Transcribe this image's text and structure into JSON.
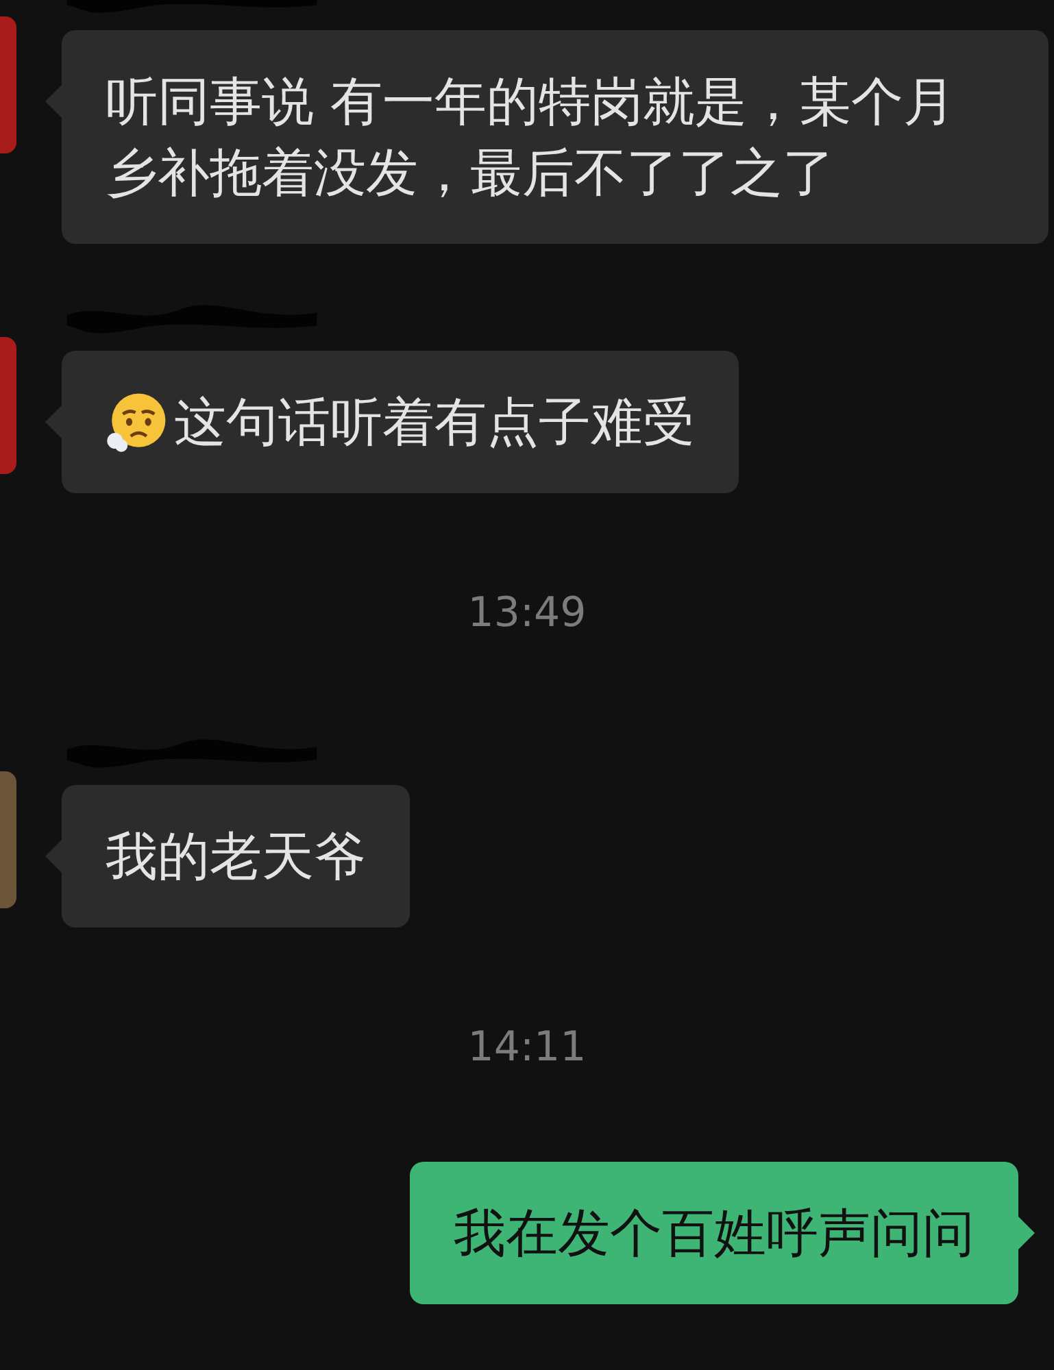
{
  "messages": [
    {
      "kind": "incoming",
      "color": "#a81c1c",
      "text": "听同事说 有一年的特岗就是，某个月乡补拖着没发，最后不了了之了",
      "emoji_prefix": false
    },
    {
      "kind": "incoming",
      "color": "#a81c1c",
      "text": "这句话听着有点子难受",
      "emoji_prefix": true
    },
    {
      "kind": "time",
      "text": "13:49"
    },
    {
      "kind": "incoming",
      "color": "#6b5538",
      "text": "我的老天爷",
      "emoji_prefix": false
    },
    {
      "kind": "time",
      "text": "14:11"
    },
    {
      "kind": "outgoing",
      "text": "我在发个百姓呼声问问"
    }
  ]
}
